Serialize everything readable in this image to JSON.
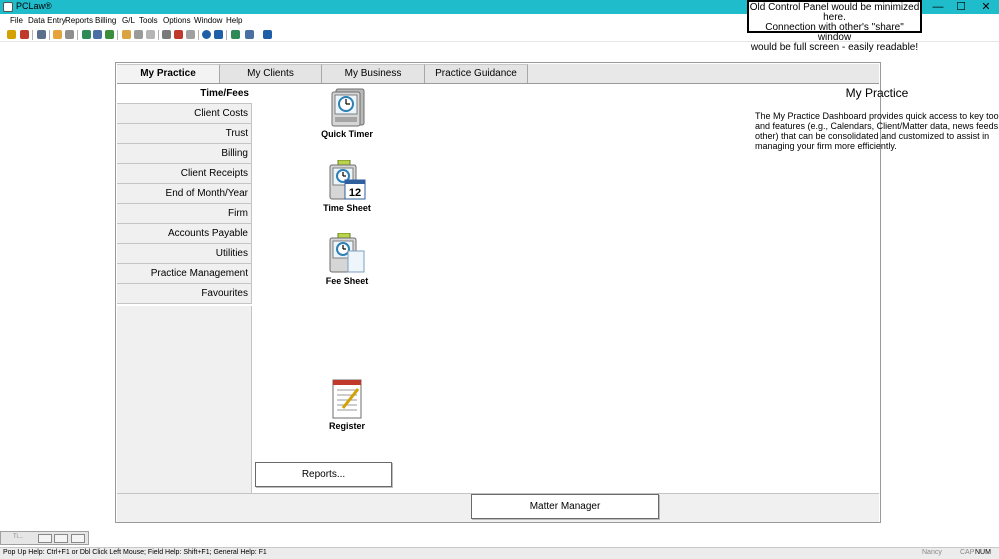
{
  "window": {
    "title": "PCLaw®",
    "minimize": "—",
    "maximize": "☐",
    "close": "✕"
  },
  "callout": {
    "line1": "Old Control Panel would be minimized here.",
    "line2": "Connection with other's \"share\" window",
    "line3": "would be full screen - easily readable!"
  },
  "menu": [
    "File",
    "Data Entry",
    "Reports",
    "Billing",
    "G/L",
    "Tools",
    "Options",
    "Window",
    "Help"
  ],
  "toolbar_icons": [
    "timer-icon",
    "calendar-icon",
    "clients-icon",
    "billing-icon",
    "print-icon",
    "money-icon",
    "register-icon",
    "report-icon",
    "note-icon",
    "doc-icon",
    "copy-icon",
    "cut-icon",
    "paste-icon",
    "find-icon",
    "help-icon",
    "context-help-icon",
    "add-icon",
    "window-icon",
    "blue-window-icon"
  ],
  "tabs": [
    "My Practice",
    "My Clients",
    "My Business",
    "Practice Guidance"
  ],
  "active_tab": "My Practice",
  "sidenav": [
    "Time/Fees",
    "Client Costs",
    "Trust",
    "Billing",
    "Client Receipts",
    "End of Month/Year",
    "Firm",
    "Accounts Payable",
    "Utilities",
    "Practice Management",
    "Favourites"
  ],
  "active_sidenav": "Time/Fees",
  "tiles": {
    "quick_timer": "Quick Timer",
    "time_sheet": "Time Sheet",
    "time_sheet_number": "12",
    "fee_sheet": "Fee Sheet",
    "register": "Register"
  },
  "info": {
    "title": "My Practice",
    "text": "The My Practice Dashboard provides quick access to key tools and features (e.g., Calendars, Client/Matter data, news feeds, other) that can be consolidated and customized to assist in managing your firm more efficiently."
  },
  "buttons": {
    "reports": "Reports...",
    "matter_manager": "Matter Manager"
  },
  "mini_task": {
    "label": "Ti..."
  },
  "status": {
    "help_text": "Pop Up Help: Ctrl+F1 or Dbl Click Left Mouse; Field Help: Shift+F1; General Help: F1",
    "user": "Nancy",
    "cap": "CAP",
    "num": "NUM"
  },
  "colors": {
    "titlebar": "#1fbccb",
    "panel_border": "#9a9a9a"
  }
}
